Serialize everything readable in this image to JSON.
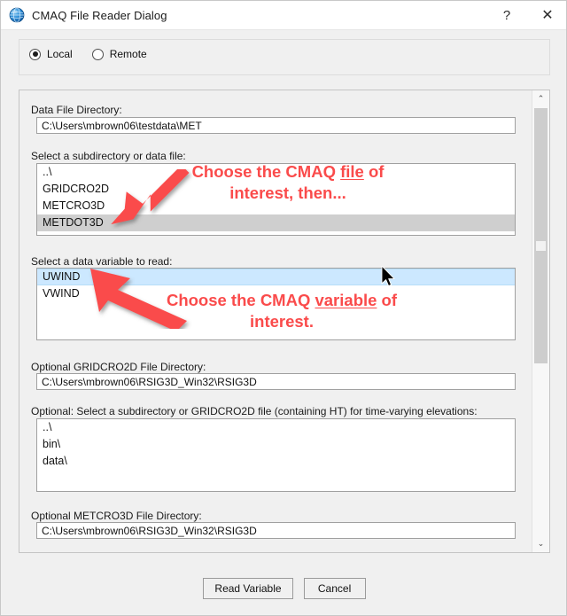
{
  "window": {
    "title": "CMAQ File Reader Dialog",
    "icon": "globe-icon",
    "help_label": "?",
    "close_label": "✕"
  },
  "mode": {
    "options": [
      {
        "label": "Local",
        "checked": true
      },
      {
        "label": "Remote",
        "checked": false
      }
    ]
  },
  "form": {
    "data_file_directory": {
      "label": "Data File Directory:",
      "value": "C:\\Users\\mbrown06\\testdata\\MET"
    },
    "subdirectory_list": {
      "label": "Select a subdirectory or data file:",
      "items": [
        "..\\",
        "GRIDCRO2D",
        "METCRO3D",
        "METDOT3D"
      ],
      "selected": "METDOT3D"
    },
    "variable_list": {
      "label": "Select a data variable to read:",
      "items": [
        "UWIND",
        "VWIND"
      ],
      "selected": "UWIND"
    },
    "gridcro2d_directory": {
      "label": "Optional GRIDCRO2D File Directory:",
      "value": "C:\\Users\\mbrown06\\RSIG3D_Win32\\RSIG3D"
    },
    "elevation_list": {
      "label": "Optional: Select a subdirectory or GRIDCRO2D file (containing HT) for time-varying elevations:",
      "items": [
        "..\\",
        "bin\\",
        "data\\"
      ],
      "selected": ""
    },
    "metcro3d_directory": {
      "label": "Optional METCRO3D File Directory:",
      "value": "C:\\Users\\mbrown06\\RSIG3D_Win32\\RSIG3D"
    }
  },
  "footer": {
    "read_variable_label": "Read Variable",
    "cancel_label": "Cancel"
  },
  "annotations": [
    {
      "line1_pre": "Choose the CMAQ ",
      "line1_underlined": "file",
      "line1_post": " of",
      "line2": "interest, then..."
    },
    {
      "line1_pre": "Choose the CMAQ ",
      "line1_underlined": "variable",
      "line1_post": " of",
      "line2": "interest."
    }
  ],
  "colors": {
    "annotation_red": "#fa4b4b",
    "selection_blue": "#cce8ff",
    "selection_gray": "#cfcfcf",
    "window_chrome": "#f0f0f0"
  },
  "scrollbar": {
    "up_arrow": "⌃",
    "down_arrow": "⌄"
  }
}
